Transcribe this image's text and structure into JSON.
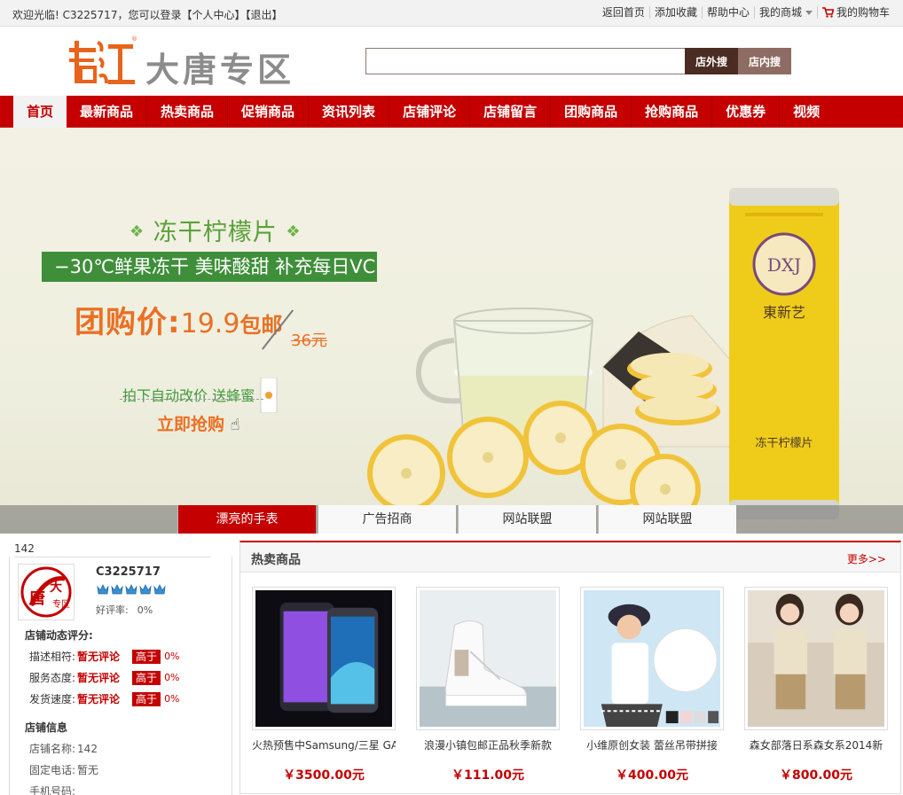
{
  "topbar": {
    "welcome": "欢迎光临! C3225717，您可以登录",
    "user_center": "【个人中心】",
    "logout": "【退出】",
    "links": [
      "返回首页",
      "添加收藏",
      "帮助中心",
      "我的商城",
      "我的购物车"
    ]
  },
  "header": {
    "logo_text": "大唐专区",
    "search_placeholder": "",
    "btn_outside": "店外搜",
    "btn_inside": "店内搜"
  },
  "nav": {
    "items": [
      "首页",
      "最新商品",
      "热卖商品",
      "促销商品",
      "资讯列表",
      "店铺评论",
      "店铺留言",
      "团购商品",
      "抢购商品",
      "优惠券",
      "视频"
    ]
  },
  "banner": {
    "title": "冻干柠檬片",
    "subtitle": "−30℃鲜果冻干 美味酸甜 补充每日VC",
    "price_label": "团购价:",
    "price_num": "19.9",
    "price_bao": "包邮",
    "old_price": "36元",
    "gift": "拍下自动改价 送蜂蜜",
    "buy": "立即抢购",
    "can_brand": "東新艺",
    "can_label": "冻干柠檬片",
    "tabs": [
      "漂亮的手表",
      "广告招商",
      "网站联盟",
      "网站联盟"
    ]
  },
  "shop": {
    "id": "142",
    "name": "C3225717",
    "good_rate_label": "好评率:",
    "good_rate": "0%",
    "dyn_title": "店铺动态评分:",
    "scores": [
      {
        "label": "描述相符:",
        "value": "暂无评论",
        "badge": "高于",
        "pct": "0%"
      },
      {
        "label": "服务态度:",
        "value": "暂无评论",
        "badge": "高于",
        "pct": "0%"
      },
      {
        "label": "发货速度:",
        "value": "暂无评论",
        "badge": "高于",
        "pct": "0%"
      }
    ],
    "info_title": "店铺信息",
    "info": [
      {
        "label": "店铺名称:",
        "value": "142"
      },
      {
        "label": "固定电话:",
        "value": "暂无"
      },
      {
        "label": "手机号码:",
        "value": ""
      }
    ]
  },
  "hot": {
    "title": "热卖商品",
    "more": "更多>>",
    "products": [
      {
        "name": "火热预售中Samsung/三星 GA",
        "price": "￥3500.00元"
      },
      {
        "name": "浪漫小镇包邮正品秋季新款",
        "price": "￥111.00元"
      },
      {
        "name": "小维原创女装 蕾丝吊带拼接",
        "price": "￥400.00元"
      },
      {
        "name": "森女部落日系森女系2014新",
        "price": "￥800.00元"
      }
    ]
  },
  "colors": {
    "brand_red": "#c40000",
    "banner_green": "#3f8f3a",
    "banner_orange": "#ea7024"
  }
}
